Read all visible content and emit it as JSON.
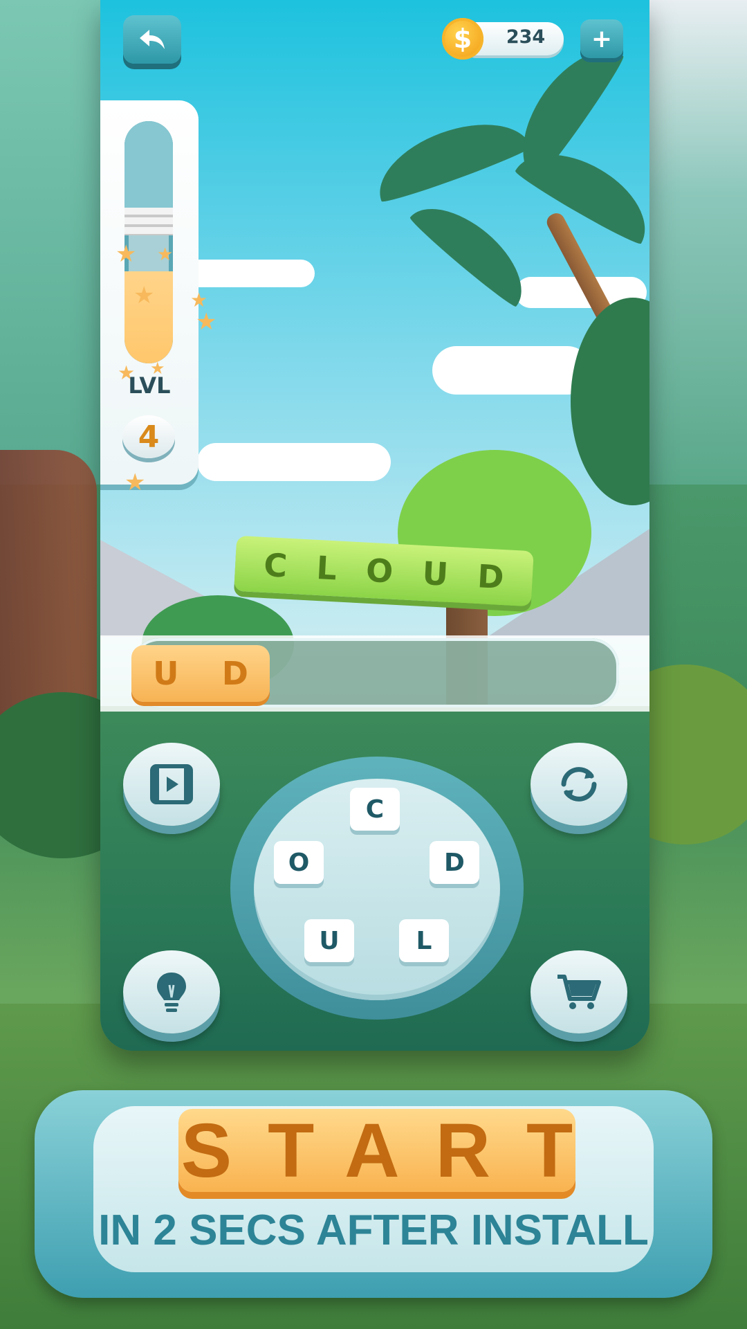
{
  "header": {
    "back_icon": "back-arrow-icon",
    "coins": "234",
    "coin_symbol": "$",
    "add_coins_label": "+"
  },
  "level": {
    "label": "LVL",
    "number": "4",
    "progress": 0.38
  },
  "word_banner": {
    "letters": [
      "C",
      "L",
      "O",
      "U",
      "D"
    ]
  },
  "answer": {
    "letters": [
      "U",
      "D"
    ]
  },
  "buttons": {
    "video_icon": "video-play-icon",
    "shuffle_icon": "shuffle-icon",
    "hint_icon": "lightbulb-icon",
    "shop_icon": "shopping-cart-icon"
  },
  "wheel": {
    "letters": [
      "C",
      "O",
      "D",
      "U",
      "L"
    ]
  },
  "cta": {
    "start_label": "START",
    "subtitle": "IN 2 SECS AFTER INSTALL"
  },
  "colors": {
    "accent_teal": "#2e98a7",
    "start_orange": "#f9b350",
    "word_green": "#8cd448"
  }
}
